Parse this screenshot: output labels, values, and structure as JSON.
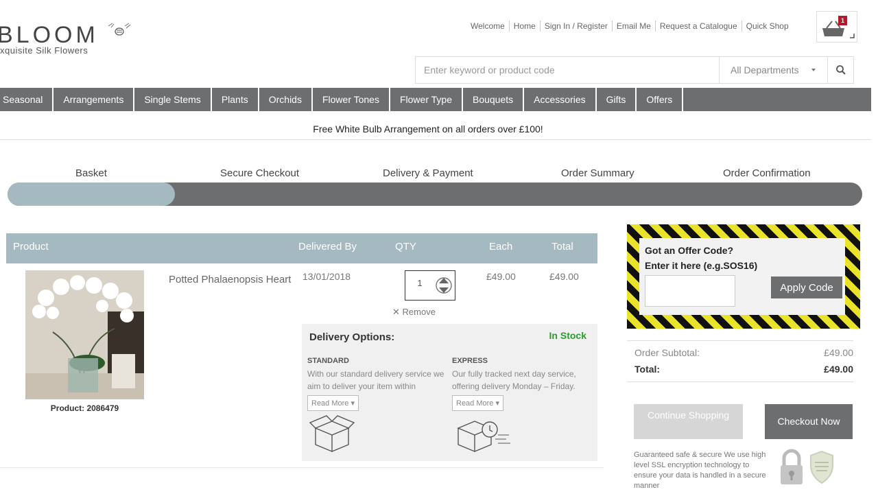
{
  "brand": {
    "name": "BLOOM",
    "tagline": "xquisite Silk Flowers"
  },
  "top_links": [
    "Welcome",
    "Home",
    "Sign In / Register",
    "Email Me",
    "Request a Catalogue",
    "Quick Shop"
  ],
  "basket": {
    "count": "1"
  },
  "search": {
    "placeholder": "Enter keyword or product code",
    "department": "All Departments"
  },
  "nav": [
    "Seasonal",
    "Arrangements",
    "Single Stems",
    "Plants",
    "Orchids",
    "Flower Tones",
    "Flower Type",
    "Bouquets",
    "Accessories",
    "Gifts",
    "Offers"
  ],
  "promo": "Free White Bulb Arrangement on all orders over £100!",
  "steps": [
    "Basket",
    "Secure Checkout",
    "Delivery & Payment",
    "Order Summary",
    "Order Confirmation"
  ],
  "progress": {
    "completed_fraction": 0.196
  },
  "table": {
    "headers": {
      "product": "Product",
      "delivered_by": "Delivered By",
      "qty": "QTY",
      "each": "Each",
      "total": "Total"
    }
  },
  "item": {
    "name": "Potted Phalaenopsis Heart",
    "code_label": "Product: 2086479",
    "delivered_by": "13/01/2018",
    "qty": "1",
    "each": "£49.00",
    "total": "£49.00",
    "remove": "Remove"
  },
  "delivery_options": {
    "title": "Delivery Options:",
    "stock": "In Stock",
    "standard": {
      "heading": "STANDARD",
      "text": "With our standard delivery service we aim to deliver your item within",
      "read_more": "Read More"
    },
    "express": {
      "heading": "EXPRESS",
      "text": "Our fully tracked next day service, offering delivery Monday – Friday.",
      "read_more": "Read More"
    }
  },
  "offer": {
    "title": "Got an Offer Code?",
    "hint": "Enter it here (e.g.SOS16)",
    "button": "Apply Code",
    "code_value": ""
  },
  "totals": {
    "subtotal_label": "Order Subtotal:",
    "subtotal_value": "£49.00",
    "total_label": "Total:",
    "total_value": "£49.00"
  },
  "actions": {
    "continue": "Continue Shopping",
    "checkout": "Checkout Now"
  },
  "security_note": "Guaranteed safe & secure We use high level SSL encryption technology to ensure your data is handled in a secure manner",
  "colors": {
    "nav_bg": "#6d6e70",
    "accent_blue_grey": "#a5b9c1",
    "stock_green": "#2b9b2b",
    "offer_yellow": "#e9e32b",
    "badge_red": "#b0182b"
  }
}
